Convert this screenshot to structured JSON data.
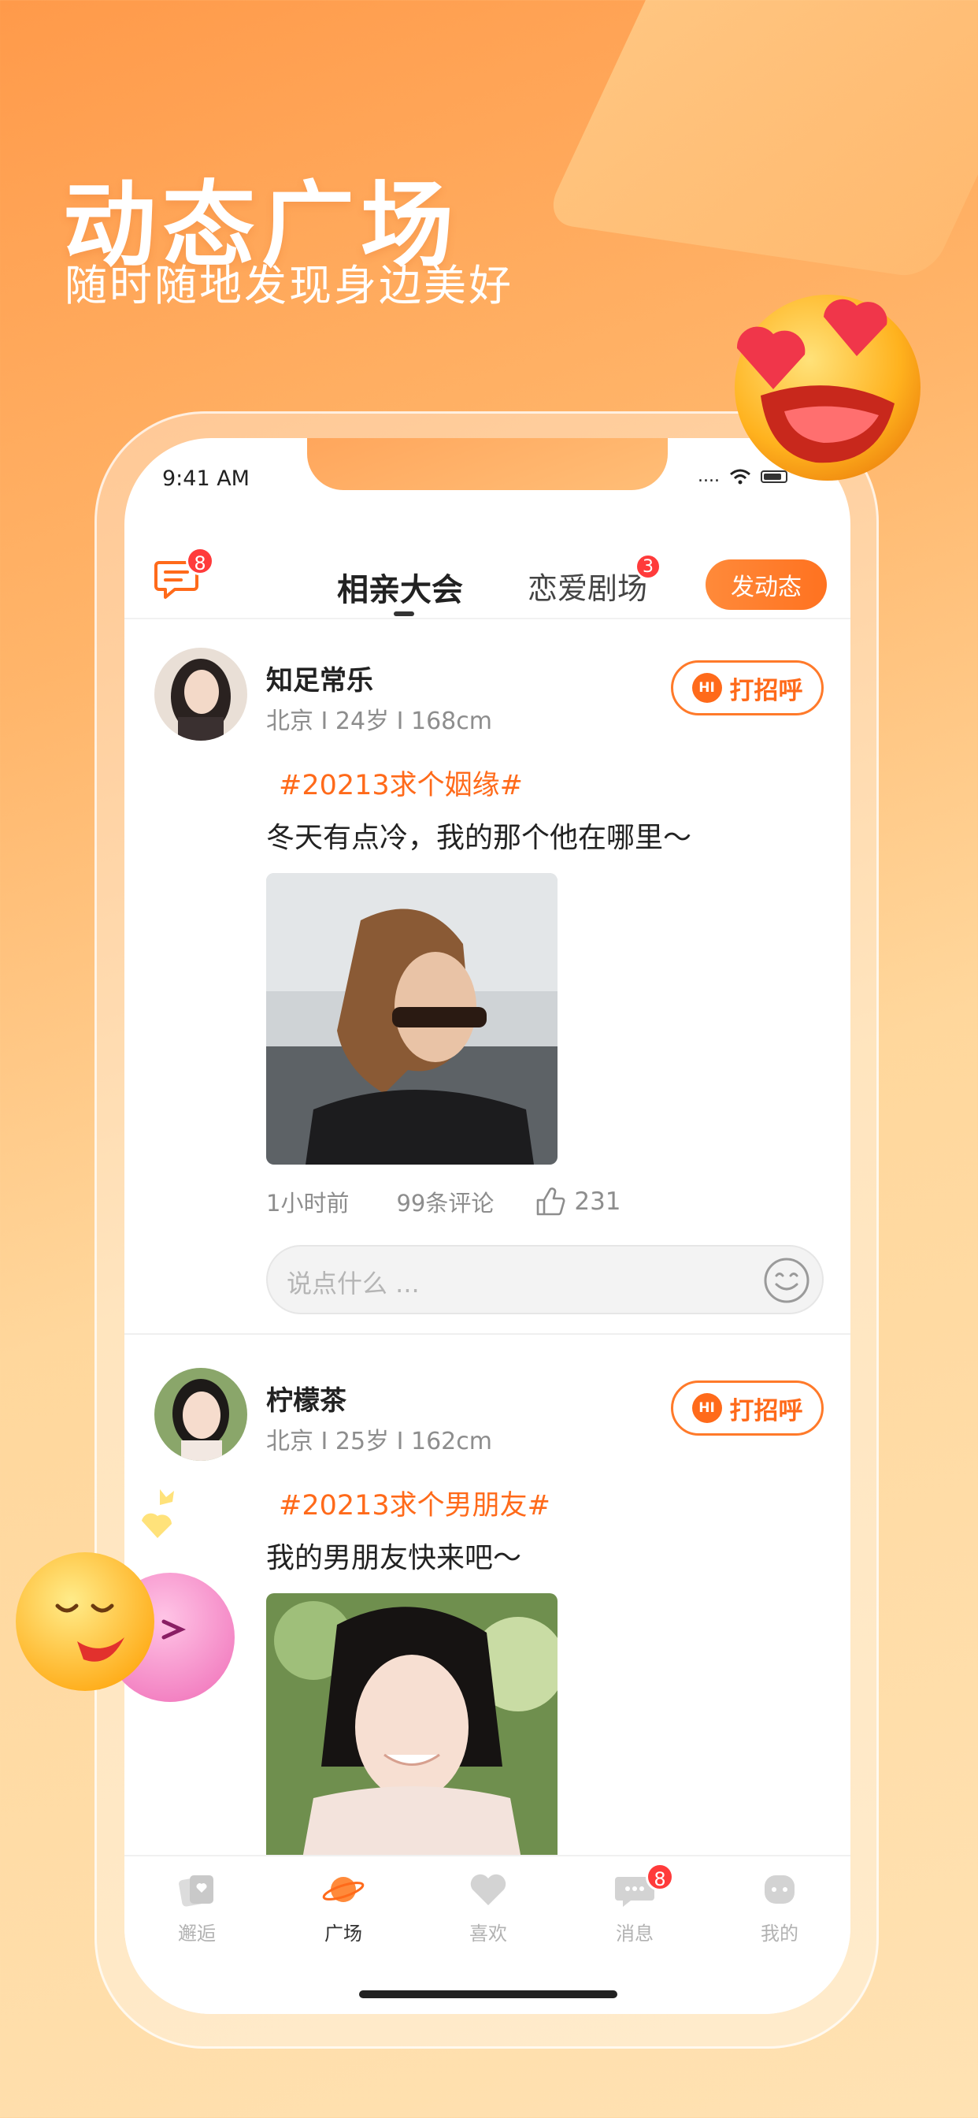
{
  "hero": {
    "title": "动态广场",
    "subtitle": "随时随地发现身边美好"
  },
  "status": {
    "time": "9:41 AM",
    "signal": "...."
  },
  "topbar": {
    "message_badge": "8",
    "tabs": [
      {
        "label": "相亲大会",
        "active": true
      },
      {
        "label": "恋爱剧场",
        "active": false,
        "badge": "3"
      }
    ],
    "post_button": "发动态"
  },
  "posts": [
    {
      "name": "知足常乐",
      "meta": "北京 I 24岁 I 168cm",
      "greet": "打招呼",
      "greet_icon": "HI",
      "topic": "#20213求个姻缘#",
      "text": "冬天有点冷，我的那个他在哪里～",
      "time": "1小时前",
      "comments": "99条评论",
      "likes": "231",
      "comment_placeholder": "说点什么 ..."
    },
    {
      "name": "柠檬茶",
      "meta": "北京 I 25岁 I 162cm",
      "greet": "打招呼",
      "greet_icon": "HI",
      "topic": "#20213求个男朋友#",
      "text": "我的男朋友快来吧～"
    }
  ],
  "tabbar": {
    "items": [
      {
        "label": "邂逅",
        "icon": "cards-icon",
        "active": false
      },
      {
        "label": "广场",
        "icon": "planet-icon",
        "active": true
      },
      {
        "label": "喜欢",
        "icon": "heart-icon",
        "active": false
      },
      {
        "label": "消息",
        "icon": "chat-icon",
        "active": false,
        "badge": "8"
      },
      {
        "label": "我的",
        "icon": "profile-icon",
        "active": false
      }
    ]
  },
  "colors": {
    "accent": "#ff6a1a",
    "badge": "#ff3b3b",
    "background_top": "#ff9a4a",
    "background_bottom": "#ffe2b3"
  }
}
